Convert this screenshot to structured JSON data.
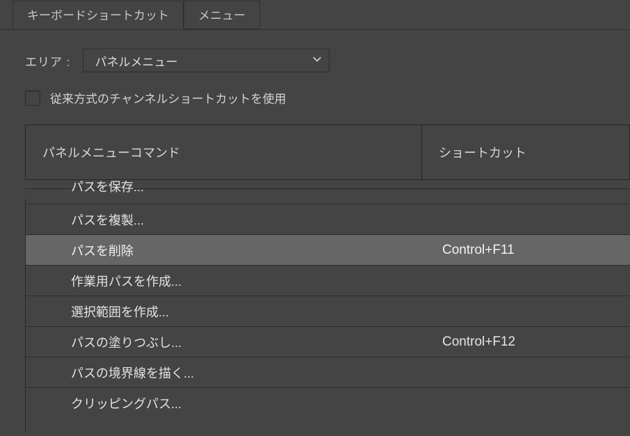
{
  "tabs": {
    "shortcuts": "キーボードショートカット",
    "menus": "メニュー"
  },
  "area": {
    "label": "エリア :",
    "value": "パネルメニュー"
  },
  "legacy": {
    "label": "従来方式のチャンネルショートカットを使用"
  },
  "headers": {
    "command": "パネルメニューコマンド",
    "shortcut": "ショートカット"
  },
  "rows": [
    {
      "cmd": "パスを保存...",
      "sc": ""
    },
    {
      "cmd": "パスを複製...",
      "sc": ""
    },
    {
      "cmd": "パスを削除",
      "sc": "Control+F11"
    },
    {
      "cmd": "作業用パスを作成...",
      "sc": ""
    },
    {
      "cmd": "選択範囲を作成...",
      "sc": ""
    },
    {
      "cmd": "パスの塗りつぶし...",
      "sc": "Control+F12"
    },
    {
      "cmd": "パスの境界線を描く...",
      "sc": ""
    },
    {
      "cmd": "クリッピングパス...",
      "sc": ""
    }
  ]
}
